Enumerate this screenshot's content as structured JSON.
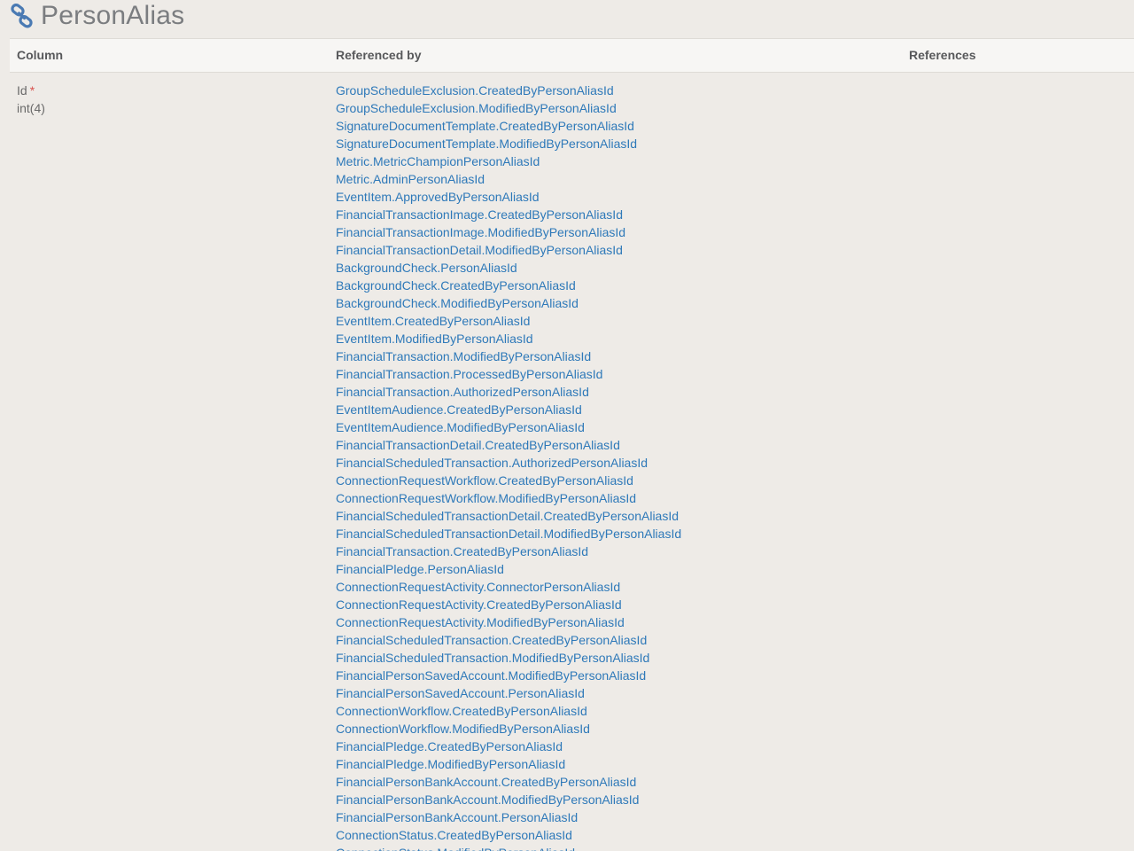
{
  "page": {
    "title": "PersonAlias",
    "icon": "link-icon"
  },
  "table": {
    "headers": {
      "column": "Column",
      "referenced_by": "Referenced by",
      "references": "References"
    },
    "rows": [
      {
        "column_name": "Id",
        "required_marker": "*",
        "column_type": "int(4)",
        "referenced_by": [
          "GroupScheduleExclusion.CreatedByPersonAliasId",
          "GroupScheduleExclusion.ModifiedByPersonAliasId",
          "SignatureDocumentTemplate.CreatedByPersonAliasId",
          "SignatureDocumentTemplate.ModifiedByPersonAliasId",
          "Metric.MetricChampionPersonAliasId",
          "Metric.AdminPersonAliasId",
          "EventItem.ApprovedByPersonAliasId",
          "FinancialTransactionImage.CreatedByPersonAliasId",
          "FinancialTransactionImage.ModifiedByPersonAliasId",
          "FinancialTransactionDetail.ModifiedByPersonAliasId",
          "BackgroundCheck.PersonAliasId",
          "BackgroundCheck.CreatedByPersonAliasId",
          "BackgroundCheck.ModifiedByPersonAliasId",
          "EventItem.CreatedByPersonAliasId",
          "EventItem.ModifiedByPersonAliasId",
          "FinancialTransaction.ModifiedByPersonAliasId",
          "FinancialTransaction.ProcessedByPersonAliasId",
          "FinancialTransaction.AuthorizedPersonAliasId",
          "EventItemAudience.CreatedByPersonAliasId",
          "EventItemAudience.ModifiedByPersonAliasId",
          "FinancialTransactionDetail.CreatedByPersonAliasId",
          "FinancialScheduledTransaction.AuthorizedPersonAliasId",
          "ConnectionRequestWorkflow.CreatedByPersonAliasId",
          "ConnectionRequestWorkflow.ModifiedByPersonAliasId",
          "FinancialScheduledTransactionDetail.CreatedByPersonAliasId",
          "FinancialScheduledTransactionDetail.ModifiedByPersonAliasId",
          "FinancialTransaction.CreatedByPersonAliasId",
          "FinancialPledge.PersonAliasId",
          "ConnectionRequestActivity.ConnectorPersonAliasId",
          "ConnectionRequestActivity.CreatedByPersonAliasId",
          "ConnectionRequestActivity.ModifiedByPersonAliasId",
          "FinancialScheduledTransaction.CreatedByPersonAliasId",
          "FinancialScheduledTransaction.ModifiedByPersonAliasId",
          "FinancialPersonSavedAccount.ModifiedByPersonAliasId",
          "FinancialPersonSavedAccount.PersonAliasId",
          "ConnectionWorkflow.CreatedByPersonAliasId",
          "ConnectionWorkflow.ModifiedByPersonAliasId",
          "FinancialPledge.CreatedByPersonAliasId",
          "FinancialPledge.ModifiedByPersonAliasId",
          "FinancialPersonBankAccount.CreatedByPersonAliasId",
          "FinancialPersonBankAccount.ModifiedByPersonAliasId",
          "FinancialPersonBankAccount.PersonAliasId",
          "ConnectionStatus.CreatedByPersonAliasId",
          "ConnectionStatus.ModifiedByPersonAliasId"
        ],
        "references": []
      }
    ]
  },
  "colors": {
    "background": "#eeebe7",
    "header_background": "#f7f6f4",
    "link": "#2e79b9",
    "title_text": "#7b7d80",
    "required_marker": "#d9534f",
    "icon": "#4a7ab3"
  }
}
